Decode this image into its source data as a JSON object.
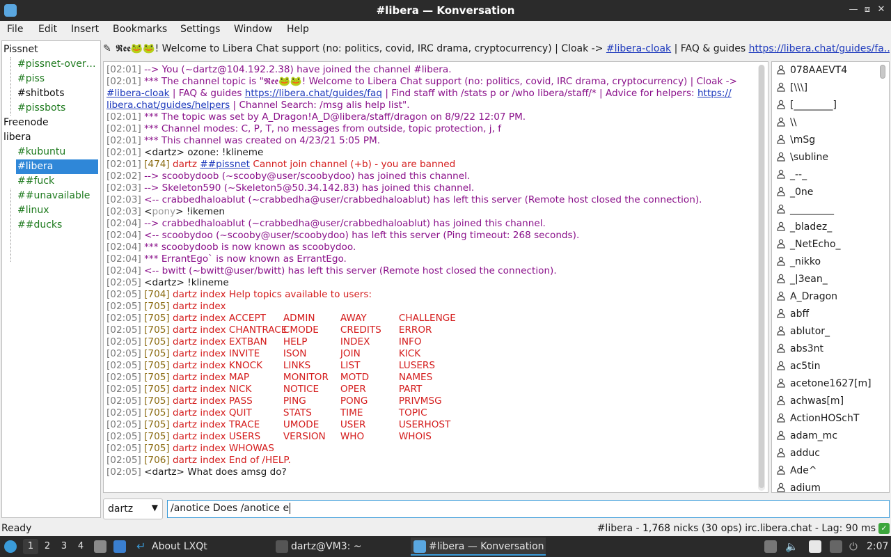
{
  "window": {
    "title": "#libera — Konversation"
  },
  "menu": [
    "File",
    "Edit",
    "Insert",
    "Bookmarks",
    "Settings",
    "Window",
    "Help"
  ],
  "tree": [
    {
      "label": "Pissnet",
      "kind": "net"
    },
    {
      "label": "#pissnet-over…",
      "kind": "chan"
    },
    {
      "label": "#piss",
      "kind": "chan"
    },
    {
      "label": "#shitbots",
      "kind": "chan-plain"
    },
    {
      "label": "#pissbots",
      "kind": "chan"
    },
    {
      "label": "Freenode",
      "kind": "net"
    },
    {
      "label": "libera",
      "kind": "net"
    },
    {
      "label": "#kubuntu",
      "kind": "chan"
    },
    {
      "label": "#libera",
      "kind": "chan-selected"
    },
    {
      "label": "##fuck",
      "kind": "chan"
    },
    {
      "label": "##unavailable",
      "kind": "chan"
    },
    {
      "label": "#linux",
      "kind": "chan"
    },
    {
      "label": "##ducks",
      "kind": "chan"
    }
  ],
  "topic": {
    "prefix": "𝕽𝖊𝖊🐸🐸! Welcome to Libera Chat support (no: politics, covid, IRC drama, cryptocurrency) | Cloak -> ",
    "link1": "#libera-cloak",
    "middle": " | FAQ & guides ",
    "link2": "https://libera.chat/guides/fa..."
  },
  "chat": [
    {
      "ts": "[02:01]",
      "segments": [
        {
          "t": "--> You (~dartz@104.192.2.38) have joined the channel #libera.",
          "c": "purple"
        }
      ]
    },
    {
      "ts": "[02:01]",
      "segments": [
        {
          "t": "*** The channel topic is \"𝕽𝖊𝖊🐸🐸! Welcome to Libera Chat support (no: politics, covid, IRC drama, cryptocurrency) | Cloak ->",
          "c": "purple"
        }
      ]
    },
    {
      "ts": "",
      "segments": [
        {
          "t": "#libera-cloak",
          "c": "link"
        },
        {
          "t": " | FAQ & guides ",
          "c": "purple"
        },
        {
          "t": "https://libera.chat/guides/faq",
          "c": "link"
        },
        {
          "t": " | Find staff with /stats p or /who libera/staff/* | Advice for helpers: ",
          "c": "purple"
        },
        {
          "t": "https://",
          "c": "link"
        }
      ]
    },
    {
      "ts": "",
      "segments": [
        {
          "t": "libera.chat/guides/helpers",
          "c": "link"
        },
        {
          "t": " | Channel Search: /msg alis help list\".",
          "c": "purple"
        }
      ]
    },
    {
      "ts": "[02:01]",
      "segments": [
        {
          "t": "*** The topic was set by A_Dragon!A_D@libera/staff/dragon on 8/9/22 12:07 PM.",
          "c": "purple"
        }
      ]
    },
    {
      "ts": "[02:01]",
      "segments": [
        {
          "t": "*** Channel modes: C, P, T, no messages from outside, topic protection, j, f",
          "c": "purple"
        }
      ]
    },
    {
      "ts": "[02:01]",
      "segments": [
        {
          "t": "*** This channel was created on 4/23/21 5:05 PM.",
          "c": "purple"
        }
      ]
    },
    {
      "ts": "[02:01]",
      "segments": [
        {
          "t": "<dartz> ozone: !klineme",
          "c": "plain"
        }
      ]
    },
    {
      "ts": "[02:01]",
      "segments": [
        {
          "t": "[474]",
          "c": "num"
        },
        {
          "t": " dartz ",
          "c": "red"
        },
        {
          "t": "##pissnet",
          "c": "link"
        },
        {
          "t": " Cannot join channel (+b) - you are banned",
          "c": "red"
        }
      ]
    },
    {
      "ts": "[02:02]",
      "segments": [
        {
          "t": "--> scoobydoob (~scooby@user/scoobydoo) has joined this channel.",
          "c": "purple"
        }
      ]
    },
    {
      "ts": "[02:03]",
      "segments": [
        {
          "t": "--> Skeleton590 (~Skeleton5@50.34.142.83) has joined this channel.",
          "c": "purple"
        }
      ]
    },
    {
      "ts": "[02:03]",
      "segments": [
        {
          "t": "<-- crabbedhaloablut (~crabbedha@user/crabbedhaloablut) has left this server (Remote host closed the connection).",
          "c": "purple"
        }
      ]
    },
    {
      "ts": "[02:03]",
      "segments": [
        {
          "t": "<",
          "c": "plain"
        },
        {
          "t": "pony",
          "c": "pony"
        },
        {
          "t": "> !ikemen",
          "c": "plain"
        }
      ]
    },
    {
      "ts": "[02:04]",
      "segments": [
        {
          "t": "--> crabbedhaloablut (~crabbedha@user/crabbedhaloablut) has joined this channel.",
          "c": "purple"
        }
      ]
    },
    {
      "ts": "[02:04]",
      "segments": [
        {
          "t": "<-- scoobydoo (~scooby@user/scoobydoo) has left this server (Ping timeout: 268 seconds).",
          "c": "purple"
        }
      ]
    },
    {
      "ts": "[02:04]",
      "segments": [
        {
          "t": "*** scoobydoob is now known as scoobydoo.",
          "c": "purple"
        }
      ]
    },
    {
      "ts": "[02:04]",
      "segments": [
        {
          "t": "*** ErrantEgo` is now known as ErrantEgo.",
          "c": "purple"
        }
      ]
    },
    {
      "ts": "[02:04]",
      "segments": [
        {
          "t": "<-- bwitt (~bwitt@user/bwitt) has left this server (Remote host closed the connection).",
          "c": "purple"
        }
      ]
    },
    {
      "ts": "[02:05]",
      "segments": [
        {
          "t": "<dartz> !klineme",
          "c": "plain"
        }
      ]
    },
    {
      "ts": "[02:05]",
      "segments": [
        {
          "t": "[704]",
          "c": "num"
        },
        {
          "t": " dartz index Help topics available to users:",
          "c": "red"
        }
      ]
    },
    {
      "ts": "[02:05]",
      "segments": [
        {
          "t": "[705]",
          "c": "num"
        },
        {
          "t": " dartz index",
          "c": "red"
        }
      ]
    },
    {
      "ts": "[02:05]",
      "help": [
        "ACCEPT",
        "ADMIN",
        "AWAY",
        "CHALLENGE"
      ]
    },
    {
      "ts": "[02:05]",
      "help": [
        "CHANTRACE",
        "CMODE",
        "CREDITS",
        "ERROR"
      ]
    },
    {
      "ts": "[02:05]",
      "help": [
        "EXTBAN",
        "HELP",
        "INDEX",
        "INFO"
      ]
    },
    {
      "ts": "[02:05]",
      "help": [
        "INVITE",
        "ISON",
        "JOIN",
        "KICK"
      ]
    },
    {
      "ts": "[02:05]",
      "help": [
        "KNOCK",
        "LINKS",
        "LIST",
        "LUSERS"
      ]
    },
    {
      "ts": "[02:05]",
      "help": [
        "MAP",
        "MONITOR",
        "MOTD",
        "NAMES"
      ]
    },
    {
      "ts": "[02:05]",
      "help": [
        "NICK",
        "NOTICE",
        "OPER",
        "PART"
      ]
    },
    {
      "ts": "[02:05]",
      "help": [
        "PASS",
        "PING",
        "PONG",
        "PRIVMSG"
      ]
    },
    {
      "ts": "[02:05]",
      "help": [
        "QUIT",
        "STATS",
        "TIME",
        "TOPIC"
      ]
    },
    {
      "ts": "[02:05]",
      "help": [
        "TRACE",
        "UMODE",
        "USER",
        "USERHOST"
      ]
    },
    {
      "ts": "[02:05]",
      "help": [
        "USERS",
        "VERSION",
        "WHO",
        "WHOIS"
      ]
    },
    {
      "ts": "[02:05]",
      "help": [
        "WHOWAS"
      ]
    },
    {
      "ts": "[02:05]",
      "segments": [
        {
          "t": "[706]",
          "c": "num"
        },
        {
          "t": " dartz index End of /HELP.",
          "c": "red"
        }
      ]
    },
    {
      "ts": "[02:05]",
      "segments": [
        {
          "t": "<dartz> What does amsg do?",
          "c": "plain"
        }
      ]
    }
  ],
  "help_prefix": {
    "num": "[705]",
    "text": " dartz index "
  },
  "nicks": [
    "078AAEVT4",
    "[\\\\\\]",
    "[________]",
    "\\\\",
    "\\mSg",
    "\\subline",
    "_--_",
    "_0ne",
    "_________",
    "_bladez_",
    "_NetEcho_",
    "_nikko",
    "_|3ean_",
    "A_Dragon",
    "abff",
    "ablutor_",
    "abs3nt",
    "ac5tin",
    "acetone1627[m]",
    "achwas[m]",
    "ActionHOSchT",
    "adam_mc",
    "adduc",
    "Ade^",
    "adium"
  ],
  "input": {
    "nick": "dartz",
    "text": "/anotice Does /anotice e"
  },
  "status": {
    "left": "Ready",
    "right": "#libera - 1,768 nicks (30 ops)  irc.libera.chat - Lag: 90 ms"
  },
  "taskbar": {
    "desktops": [
      "1",
      "2",
      "3",
      "4"
    ],
    "tasks": [
      "About LXQt",
      "dartz@VM3: ~",
      "#libera — Konversation"
    ],
    "clock": "2:07"
  },
  "colors": {
    "accent": "#2f87d8",
    "purple": "#8a118a",
    "red": "#d41c1c",
    "green": "#1e7a1e"
  }
}
